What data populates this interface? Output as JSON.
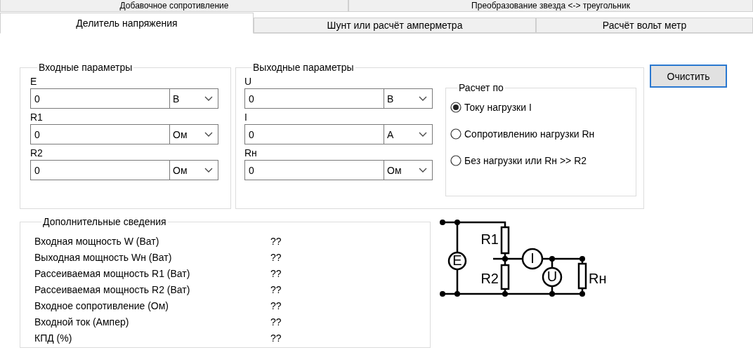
{
  "tabs_back": [
    {
      "label": "Добавочное сопротивление",
      "selected": false
    },
    {
      "label": "Преобразование звезда <-> треугольник",
      "selected": false
    }
  ],
  "tabs": [
    {
      "label": "Делитель напряжения",
      "selected": true
    },
    {
      "label": "Шунт или расчёт амперметра",
      "selected": false
    },
    {
      "label": "Расчёт вольт метр",
      "selected": false
    }
  ],
  "input_group": {
    "title": "Входные параметры",
    "fields": [
      {
        "label": "E",
        "value": "0",
        "unit": "В"
      },
      {
        "label": "R1",
        "value": "0",
        "unit": "Ом"
      },
      {
        "label": "R2",
        "value": "0",
        "unit": "Ом"
      }
    ]
  },
  "output_group": {
    "title": "Выходные параметры",
    "fields": [
      {
        "label": "U",
        "value": "0",
        "unit": "В"
      },
      {
        "label": "I",
        "value": "0",
        "unit": "А"
      },
      {
        "label": "Rн",
        "value": "0",
        "unit": "Ом"
      }
    ],
    "mode_group": {
      "title": "Расчет по",
      "options": [
        {
          "label": "Току нагрузки I",
          "selected": true
        },
        {
          "label": "Сопротивлению нагрузки Rн",
          "selected": false
        },
        {
          "label": "Без нагрузки или Rн >> R2",
          "selected": false
        }
      ]
    }
  },
  "clear_button": "Очистить",
  "info_group": {
    "title": "Дополнительные сведения",
    "rows": [
      {
        "label": "Входная мощность W (Ват)",
        "value": "??"
      },
      {
        "label": "Выходная мощность Wн (Ват)",
        "value": "??"
      },
      {
        "label": "Рассеиваемая мощность R1 (Ват)",
        "value": "??"
      },
      {
        "label": "Рассеиваемая мощность R2 (Ват)",
        "value": "??"
      },
      {
        "label": "Входное сопротивление (Ом)",
        "value": "??"
      },
      {
        "label": "Входной ток (Ампер)",
        "value": "??"
      },
      {
        "label": "КПД (%)",
        "value": "??"
      }
    ]
  },
  "circuit": {
    "source": "E",
    "ammeter": "I",
    "voltmeter": "U",
    "r1": "R1",
    "r2": "R2",
    "load": "Rн"
  }
}
